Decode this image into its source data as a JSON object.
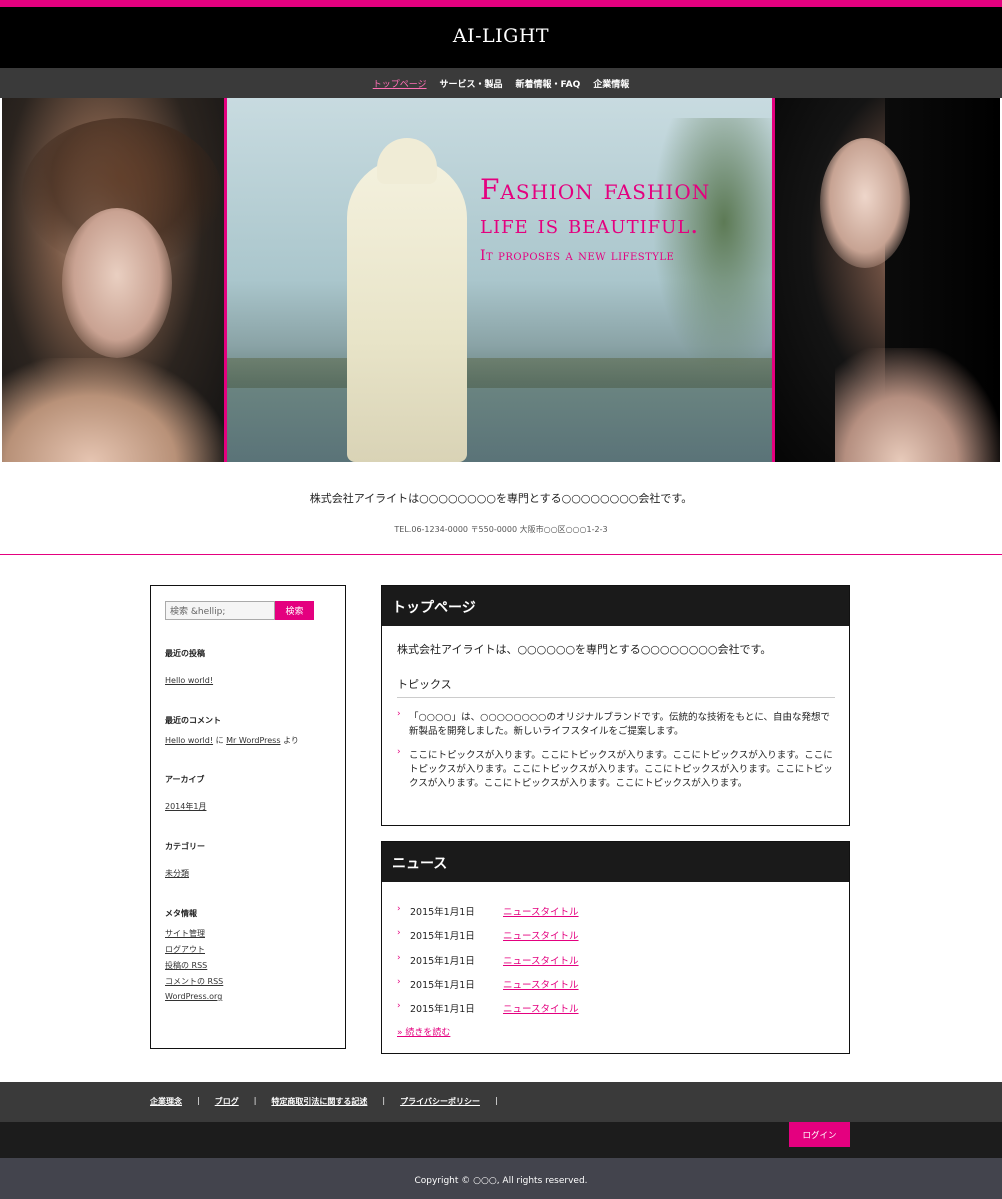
{
  "site": {
    "title": "AI-LIGHT"
  },
  "nav": {
    "items": [
      {
        "label": "トップページ",
        "active": true
      },
      {
        "label": "サービス・製品",
        "active": false
      },
      {
        "label": "新着情報・FAQ",
        "active": false
      },
      {
        "label": "企業情報",
        "active": false
      }
    ]
  },
  "hero": {
    "line1": "Fashion fashion",
    "line2": "life is beautiful.",
    "line3": "It proposes a new lifestyle"
  },
  "intro": {
    "text": "株式会社アイライトは○○○○○○○○を専門とする○○○○○○○○会社です。",
    "contact": "TEL.06-1234-0000 〒550-0000 大阪市○○区○○○1-2-3"
  },
  "sidebar": {
    "search": {
      "placeholder": "検索 &hellip;",
      "button": "検索"
    },
    "recent_posts": {
      "title": "最近の投稿",
      "items": [
        "Hello world!"
      ]
    },
    "recent_comments": {
      "title": "最近のコメント",
      "post": "Hello world!",
      "on": "に",
      "author": "Mr WordPress",
      "suffix": "より"
    },
    "archives": {
      "title": "アーカイブ",
      "items": [
        "2014年1月"
      ]
    },
    "categories": {
      "title": "カテゴリー",
      "items": [
        "未分類"
      ]
    },
    "meta": {
      "title": "メタ情報",
      "items": [
        "サイト管理",
        "ログアウト",
        "投稿の RSS",
        "コメントの RSS",
        "WordPress.org"
      ]
    }
  },
  "top": {
    "heading": "トップページ",
    "lead": "株式会社アイライトは、○○○○○○を専門とする○○○○○○○○会社です。",
    "topics_heading": "トピックス",
    "topics": [
      "「○○○○」は、○○○○○○○○のオリジナルブランドです。伝統的な技術をもとに、自由な発想で新製品を開発しました。新しいライフスタイルをご提案します。",
      "ここにトピックスが入ります。ここにトピックスが入ります。ここにトピックスが入ります。ここにトピックスが入ります。ここにトピックスが入ります。ここにトピックスが入ります。ここにトピックスが入ります。ここにトピックスが入ります。ここにトピックスが入ります。"
    ]
  },
  "news": {
    "heading": "ニュース",
    "items": [
      {
        "date": "2015年1月1日",
        "title": "ニュースタイトル"
      },
      {
        "date": "2015年1月1日",
        "title": "ニュースタイトル"
      },
      {
        "date": "2015年1月1日",
        "title": "ニュースタイトル"
      },
      {
        "date": "2015年1月1日",
        "title": "ニュースタイトル"
      },
      {
        "date": "2015年1月1日",
        "title": "ニュースタイトル"
      }
    ],
    "more": "» 続きを読む"
  },
  "footer": {
    "links": [
      "企業理念",
      "ブログ",
      "特定商取引法に関する記述",
      "プライバシーポリシー"
    ],
    "separator": "|",
    "login": "ログイン",
    "copyright": "Copyright © ○○○, All rights reserved."
  },
  "colors": {
    "accent": "#e4007f",
    "dark": "#1a1a1a",
    "nav": "#3a3a3a",
    "footer_bottom": "#43444d"
  }
}
